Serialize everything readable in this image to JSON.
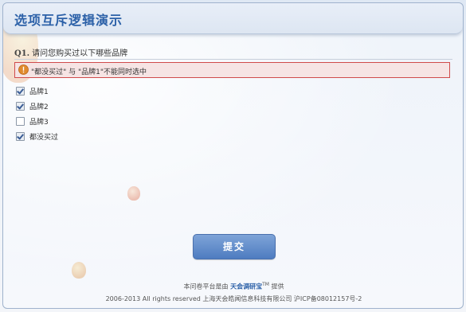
{
  "header": {
    "title": "选项互斥逻辑演示"
  },
  "question": {
    "number": "Q1.",
    "text": "请问您购买过以下哪些品牌"
  },
  "alert": {
    "icon": "warning-icon",
    "message": "\"都没买过\" 与 \"品牌1\"不能同时选中",
    "border_color": "#d04b4b"
  },
  "options": [
    {
      "label": "品牌1",
      "checked": true
    },
    {
      "label": "品牌2",
      "checked": true
    },
    {
      "label": "品牌3",
      "checked": false
    },
    {
      "label": "都没买过",
      "checked": true
    }
  ],
  "submit": {
    "label": "提交"
  },
  "footer": {
    "line1_prefix": "本问卷平台是由",
    "line1_brand": "天会调研宝",
    "line1_tm": "TM",
    "line1_suffix": "提供",
    "line2": "2006-2013 All rights reserved 上海天会皓闻信息科技有限公司 沪ICP备08012157号-2"
  },
  "colors": {
    "accent": "#2c61a8",
    "button": "#5a86c6"
  }
}
